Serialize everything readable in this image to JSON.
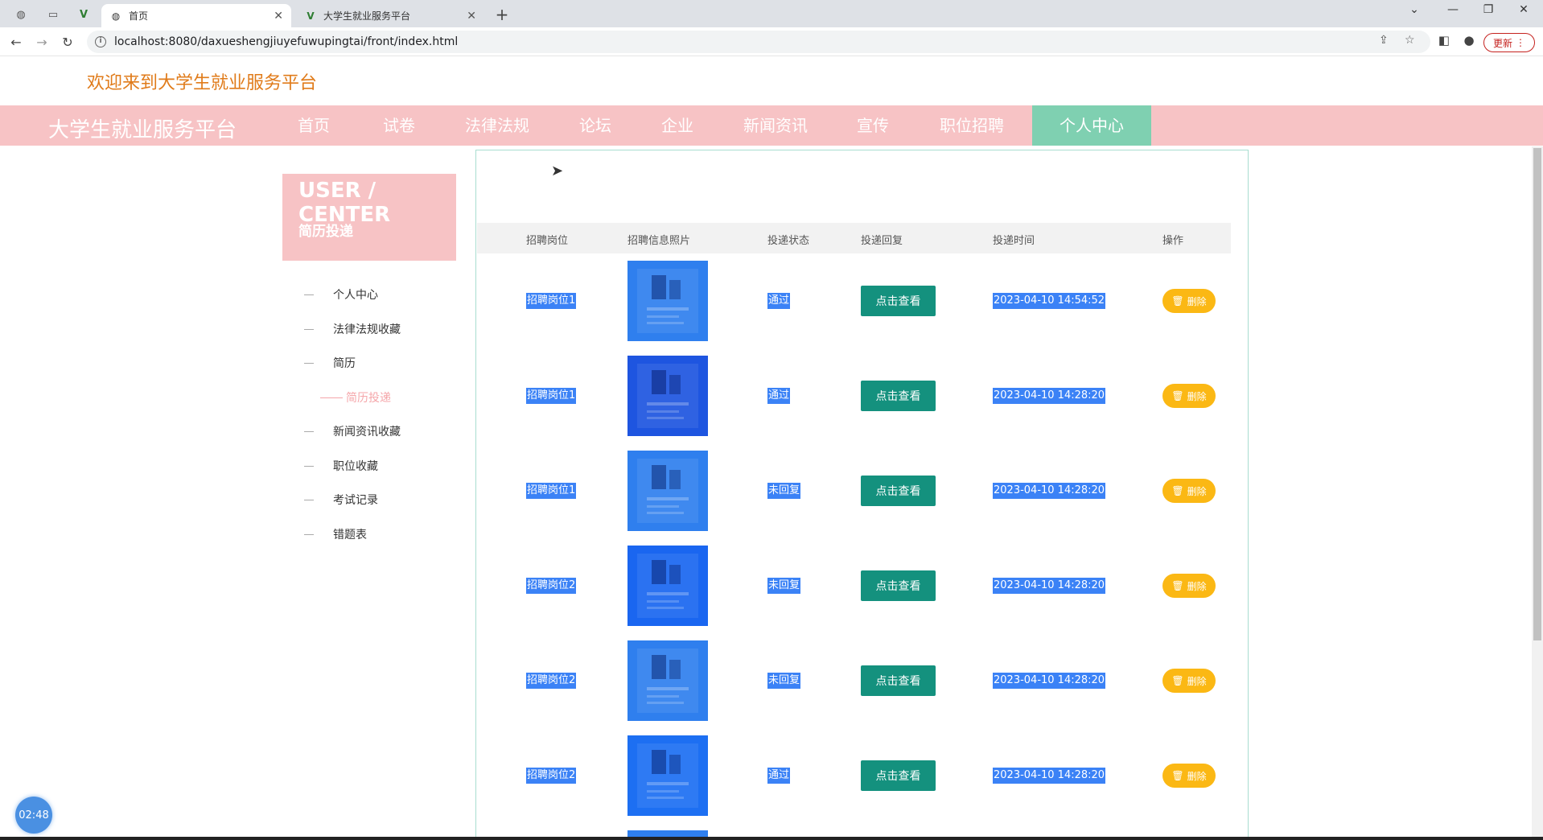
{
  "browser": {
    "tabs": [
      {
        "title": "首页",
        "icon": "globe-icon"
      },
      {
        "title": "大学生就业服务平台",
        "icon": "vue-logo-icon"
      }
    ],
    "url": "localhost:8080/daxueshengjiuyefuwupingtai/front/index.html",
    "update_label": "更新"
  },
  "header": {
    "welcome": "欢迎来到大学生就业服务平台",
    "brand": "大学生就业服务平台"
  },
  "nav": {
    "items": [
      "首页",
      "试卷",
      "法律法规",
      "论坛",
      "企业",
      "新闻资讯",
      "宣传",
      "职位招聘",
      "个人中心"
    ],
    "active": "个人中心",
    "colors": {
      "bar": "#f7c3c5",
      "active": "#7fd0b1"
    }
  },
  "user_center": {
    "title": "USER / CENTER",
    "subtitle": "简历投递"
  },
  "sidebar": {
    "items": [
      "个人中心",
      "法律法规收藏",
      "简历",
      "简历投递",
      "新闻资讯收藏",
      "职位收藏",
      "考试记录",
      "错题表"
    ],
    "active_sub": "简历投递"
  },
  "table": {
    "headers": [
      "招聘岗位",
      "招聘信息照片",
      "投递状态",
      "投递回复",
      "投递时间",
      "操作"
    ],
    "view_label": "点击查看",
    "delete_label": "删除",
    "rows": [
      {
        "position": "招聘岗位1",
        "status": "通过",
        "time": "2023-04-10 14:54:52"
      },
      {
        "position": "招聘岗位1",
        "status": "通过",
        "time": "2023-04-10 14:28:20"
      },
      {
        "position": "招聘岗位1",
        "status": "未回复",
        "time": "2023-04-10 14:28:20"
      },
      {
        "position": "招聘岗位2",
        "status": "未回复",
        "time": "2023-04-10 14:28:20"
      },
      {
        "position": "招聘岗位2",
        "status": "未回复",
        "time": "2023-04-10 14:28:20"
      },
      {
        "position": "招聘岗位2",
        "status": "通过",
        "time": "2023-04-10 14:28:20"
      }
    ],
    "colors": {
      "view_button": "#14917e",
      "delete_button": "#fbb814",
      "selection": "#3b82f6"
    }
  },
  "timer": "02:48"
}
